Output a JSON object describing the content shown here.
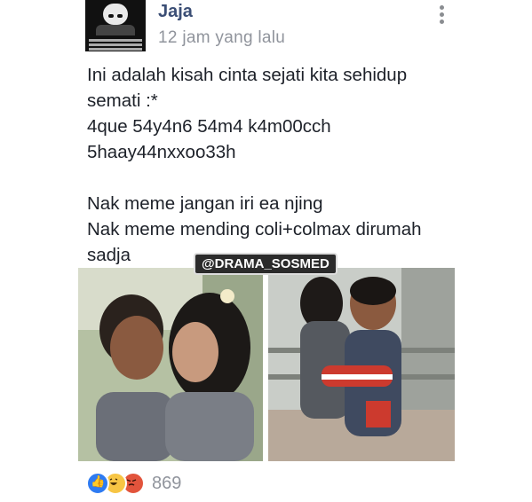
{
  "post": {
    "author": "Jaja",
    "timestamp": "12 jam yang lalu",
    "text": "Ini adalah kisah cinta sejati kita sehidup\nsemati :*\n4que 54y4n6 54m4 k4m00cch\n5haay44nxxoo33h\n\nNak meme jangan iri ea njing\nNak meme mending coli+colmax dirumah\nsadja",
    "watermark": "@DRAMA_SOSMED"
  },
  "reactions": {
    "types": [
      "like",
      "haha",
      "angry"
    ],
    "count": "869"
  },
  "colors": {
    "author": "#3b4e75",
    "meta": "#90949c",
    "like": "#2e7bf2",
    "haha": "#f7c544",
    "angry": "#e2543c"
  }
}
